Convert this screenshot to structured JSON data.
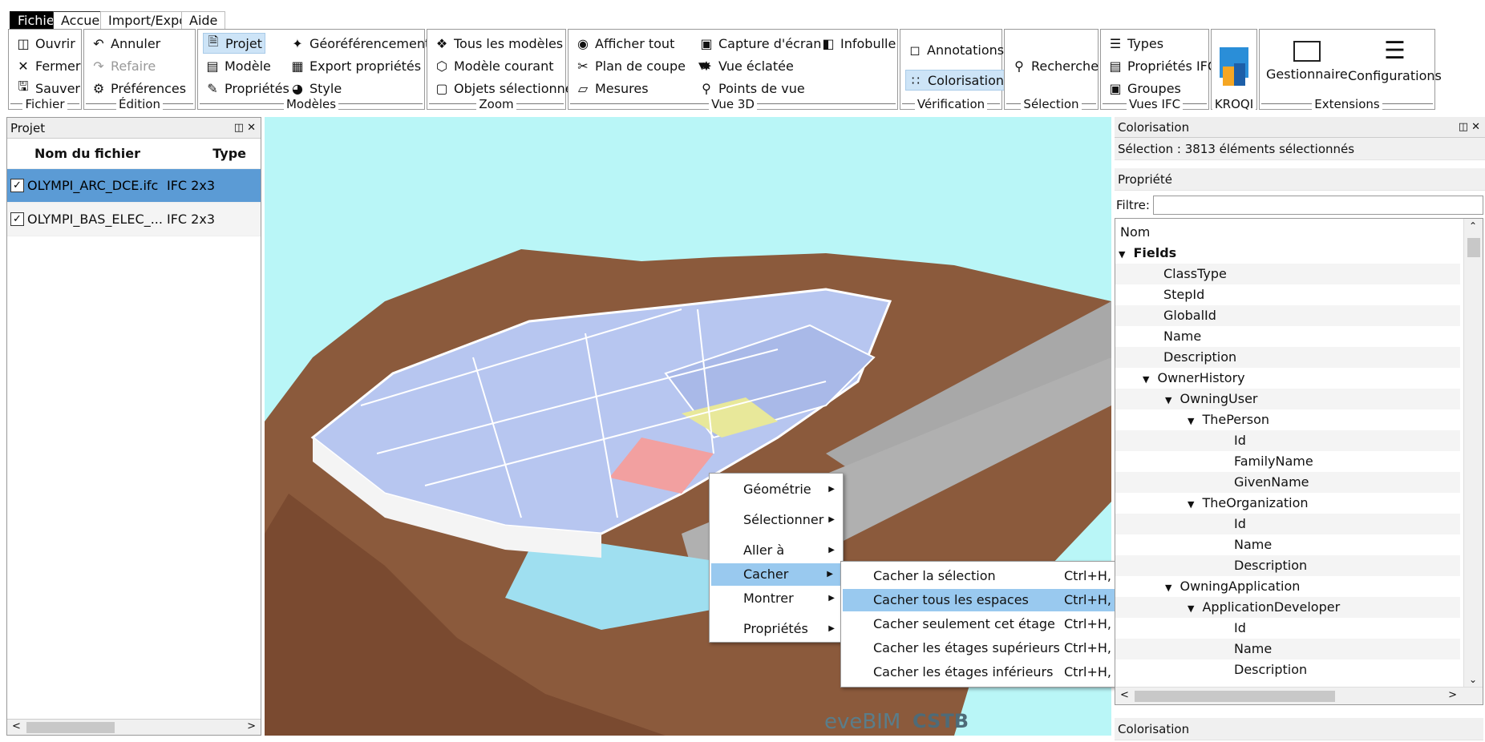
{
  "tabs": {
    "fichier": "Fichier",
    "accueil": "Accueil",
    "import": "Import/Export",
    "aide": "Aide"
  },
  "ribbon": {
    "fichier": {
      "title": "Fichier",
      "ouvrir": "Ouvrir",
      "fermer": "Fermer",
      "sauver": "Sauver"
    },
    "edition": {
      "title": "Édition",
      "annuler": "Annuler",
      "refaire": "Refaire",
      "preferences": "Préférences"
    },
    "modeles": {
      "title": "Modèles",
      "projet": "Projet",
      "modele": "Modèle",
      "proprietes": "Propriétés",
      "georef": "Géoréférencement",
      "export": "Export propriétés",
      "style": "Style"
    },
    "zoom": {
      "title": "Zoom",
      "tous": "Tous les modèles",
      "courant": "Modèle courant",
      "objets": "Objets sélectionnés"
    },
    "vue3d": {
      "title": "Vue 3D",
      "afficher": "Afficher tout",
      "plan": "Plan de coupe",
      "mesures": "Mesures",
      "capture": "Capture d'écran",
      "eclatee": "Vue éclatée",
      "points": "Points de vue",
      "infobulle": "Infobulle"
    },
    "verification": {
      "title": "Vérification",
      "annotations": "Annotations",
      "colorisation": "Colorisation"
    },
    "selection": {
      "title": "Sélection",
      "recherche": "Recherche"
    },
    "vuesifc": {
      "title": "Vues IFC",
      "types": "Types",
      "proprietes": "Propriétés IFC",
      "groupes": "Groupes"
    },
    "kroqi": {
      "title": "KROQI"
    },
    "extensions": {
      "title": "Extensions",
      "gestionnaire": "Gestionnaire",
      "configurations": "Configurations"
    }
  },
  "project_panel": {
    "title": "Projet",
    "col_name": "Nom du fichier",
    "col_type": "Type",
    "files": [
      {
        "name": "OLYMPI_ARC_DCE.ifc",
        "type": "IFC 2x3"
      },
      {
        "name": "OLYMPI_BAS_ELEC_...",
        "type": "IFC 2x3"
      }
    ]
  },
  "viewport": {
    "logo1": "eveBIM",
    "logo2": "CSTB",
    "colors": {
      "sky": "#b9f6f7",
      "terrain": "#8b5a3c",
      "building": "#b7c6f0"
    }
  },
  "context_menu": {
    "items": [
      "Géométrie",
      "Sélectionner",
      "Aller à",
      "Cacher",
      "Montrer",
      "Propriétés"
    ]
  },
  "submenu": {
    "items": [
      {
        "label": "Cacher la sélection",
        "shortcut": "Ctrl+H, Ctrl+H"
      },
      {
        "label": "Cacher tous les espaces",
        "shortcut": "Ctrl+H, Ctrl+A"
      },
      {
        "label": "Cacher seulement cet étage",
        "shortcut": "Ctrl+H, Ctrl+B"
      },
      {
        "label": "Cacher les étages supérieurs",
        "shortcut": "Ctrl+H, Ctrl+U"
      },
      {
        "label": "Cacher les étages inférieurs",
        "shortcut": "Ctrl+H, Ctrl+L"
      }
    ]
  },
  "color_panel": {
    "title": "Colorisation",
    "selection": "Sélection : 3813 éléments sélectionnés",
    "propriete": "Propriété",
    "filter_label": "Filtre:",
    "filter_value": "",
    "footer": "Colorisation",
    "tree": [
      "Nom",
      "Fields",
      "ClassType",
      "StepId",
      "GlobalId",
      "Name",
      "Description",
      "OwnerHistory",
      "OwningUser",
      "ThePerson",
      "Id",
      "FamilyName",
      "GivenName",
      "TheOrganization",
      "Id",
      "Name",
      "Description",
      "OwningApplication",
      "ApplicationDeveloper",
      "Id",
      "Name",
      "Description"
    ]
  }
}
